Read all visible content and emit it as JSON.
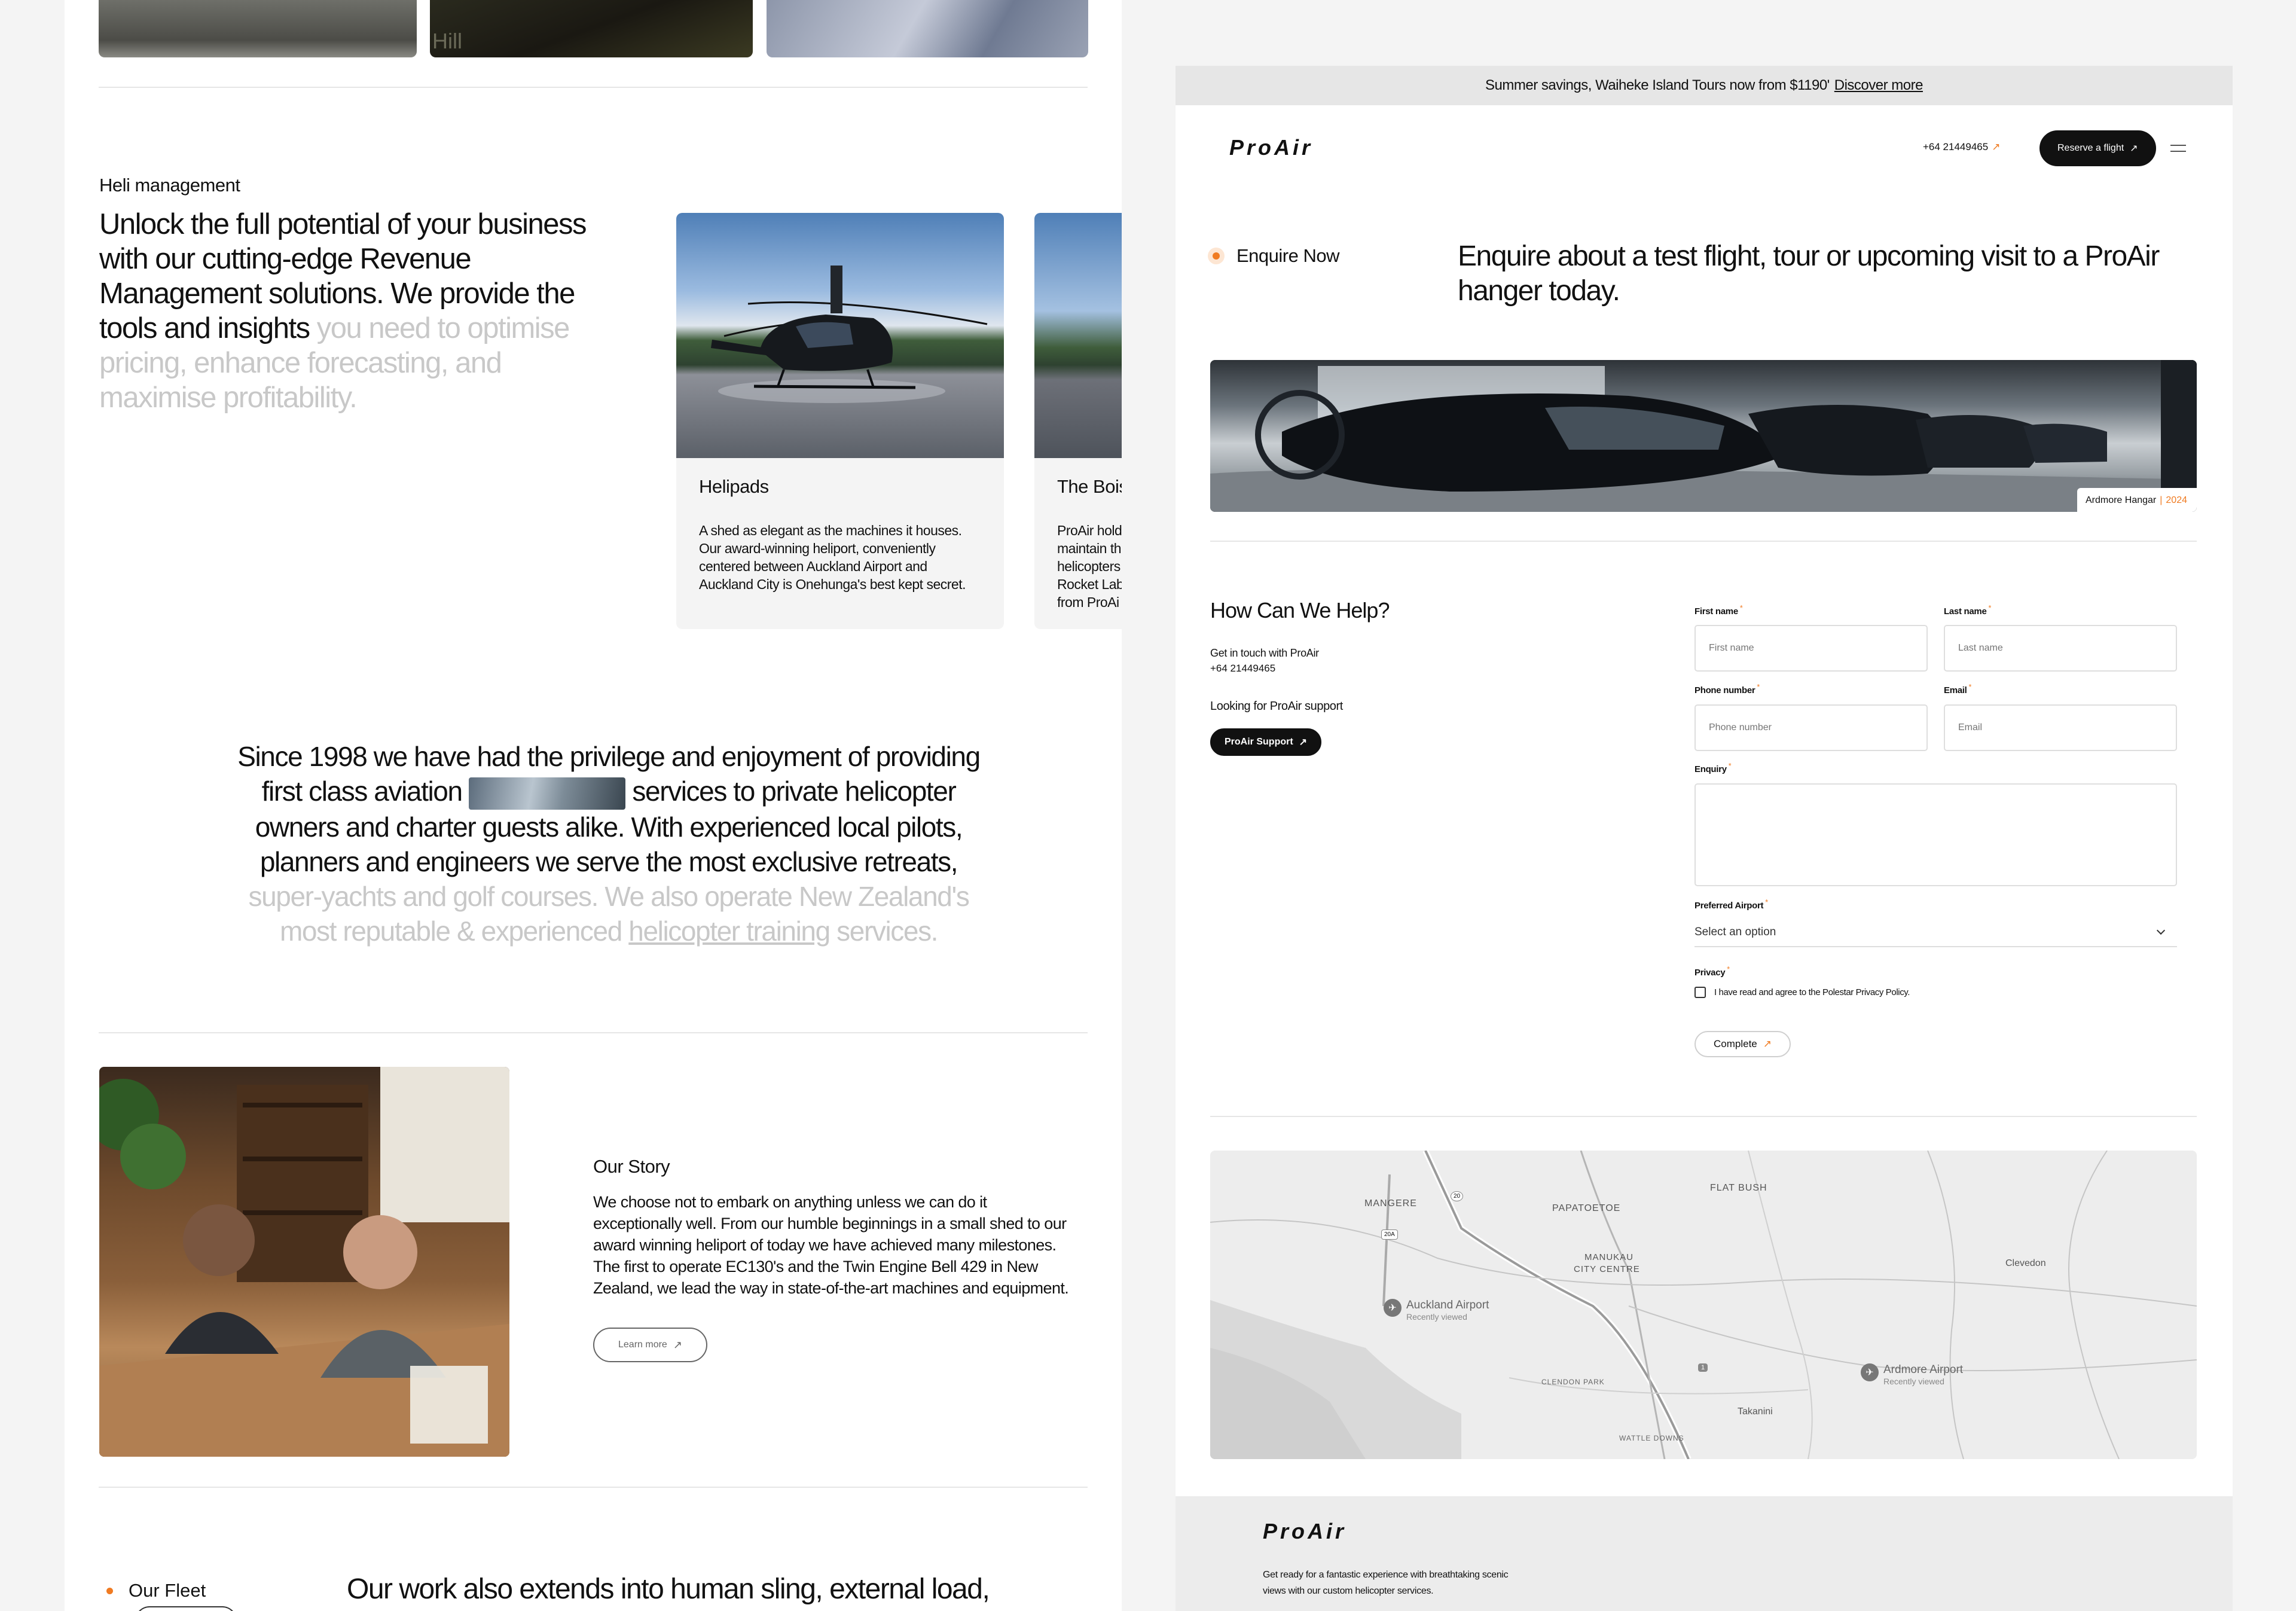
{
  "left_page": {
    "top_images": [
      {
        "alt": "hangar-floor-photo"
      },
      {
        "alt": "night-helipad-photo",
        "overlay_text": "Hill"
      },
      {
        "alt": "fabric-detail-photo"
      }
    ],
    "heli_management": {
      "eyebrow": "Heli management",
      "lede_strong": "Unlock the full potential of your business with our cutting-edge Revenue Management solutions. We provide the tools and insights",
      "lede_faded": " you need to optimise pricing, enhance forecasting, and maximise profitability."
    },
    "cards": [
      {
        "title": "Helipads",
        "body": "A shed as elegant as the machines it houses. Our award-winning heliport, conveniently centered between Auckland Airport and Auckland City is Onehunga's best kept secret."
      },
      {
        "title": "The Bois",
        "body_lines": [
          "ProAir hold",
          "maintain th",
          "helicopters",
          "Rocket Lab",
          "from ProAi"
        ]
      }
    ],
    "since": {
      "line_a": "Since 1998 we have had the privilege and enjoyment of providing",
      "line_b_pre": "first class aviation",
      "line_b_post": " services to private helicopter",
      "line_c": "owners and charter guests alike. With experienced local pilots,",
      "line_d": "planners and engineers we serve the most exclusive retreats,",
      "line_e_faded": "super-yachts and golf courses. We also operate New Zealand's",
      "line_f_faded_pre": "most reputable & experienced ",
      "line_f_link": "helicopter training",
      "line_f_faded_post": " services."
    },
    "our_story": {
      "title": "Our Story",
      "body": "We choose not to embark on anything unless we can do it exceptionally well. From our humble beginnings in a small shed to our award winning heliport of today we have achieved many milestones. The first to operate EC130's and the Twin Engine Bell 429 in New Zealand, we lead the way in state-of-the-art machines and equipment.",
      "button": "Learn more"
    },
    "our_fleet": {
      "label": "Our Fleet",
      "heading": "Our work also extends into human sling, external load,"
    }
  },
  "right_page": {
    "banner": {
      "text": "Summer savings, Waiheke Island Tours now from $1190'",
      "link": "Discover more"
    },
    "header": {
      "logo": "ProAir",
      "phone": "+64 21449465",
      "cta": "Reserve a flight"
    },
    "enquire": {
      "label": "Enquire Now",
      "heading": "Enquire about a test flight, tour or upcoming visit to a ProAir hanger today."
    },
    "hero_caption": {
      "place": "Ardmore Hangar",
      "separator": "|",
      "year": "2024"
    },
    "help": {
      "title": "How Can We Help?",
      "contact_intro": "Get in touch with ProAir",
      "contact_phone": "+64 21449465",
      "support_label": "Looking for ProAir support",
      "support_button": "ProAir Support"
    },
    "form": {
      "first_name": {
        "label": "First name",
        "placeholder": "First name"
      },
      "last_name": {
        "label": "Last name",
        "placeholder": "Last name"
      },
      "phone": {
        "label": "Phone number",
        "placeholder": "Phone number"
      },
      "email": {
        "label": "Email",
        "placeholder": "Email"
      },
      "enquiry": {
        "label": "Enquiry"
      },
      "airport": {
        "label": "Preferred Airport",
        "selected": "Select an option"
      },
      "privacy": {
        "label": "Privacy",
        "consent": "I have read and agree to the Polestar Privacy Policy.",
        "checked": false
      },
      "submit": "Complete",
      "required_mark": "*"
    },
    "map": {
      "places": [
        "MANGERE",
        "PAPATOETOE",
        "FLAT BUSH",
        "MANUKAU",
        "CITY CENTRE",
        "Clevedon",
        "CLENDON PARK",
        "Takanini",
        "WATTLE DOWNS"
      ],
      "road_shields": [
        "20",
        "20A",
        "1"
      ],
      "airports": [
        {
          "name": "Auckland Airport",
          "note": "Recently viewed"
        },
        {
          "name": "Ardmore Airport",
          "note": "Recently viewed"
        }
      ]
    },
    "footer": {
      "logo": "ProAir",
      "tagline_1": "Get ready for a fantastic experience with breathtaking scenic",
      "tagline_2": "views with our custom helicopter services."
    }
  },
  "colors": {
    "accent": "#f07b22",
    "ink": "#111111",
    "faded": "#c8c8c8",
    "panel": "#f4f4f4",
    "banner": "#e6e6e6"
  }
}
